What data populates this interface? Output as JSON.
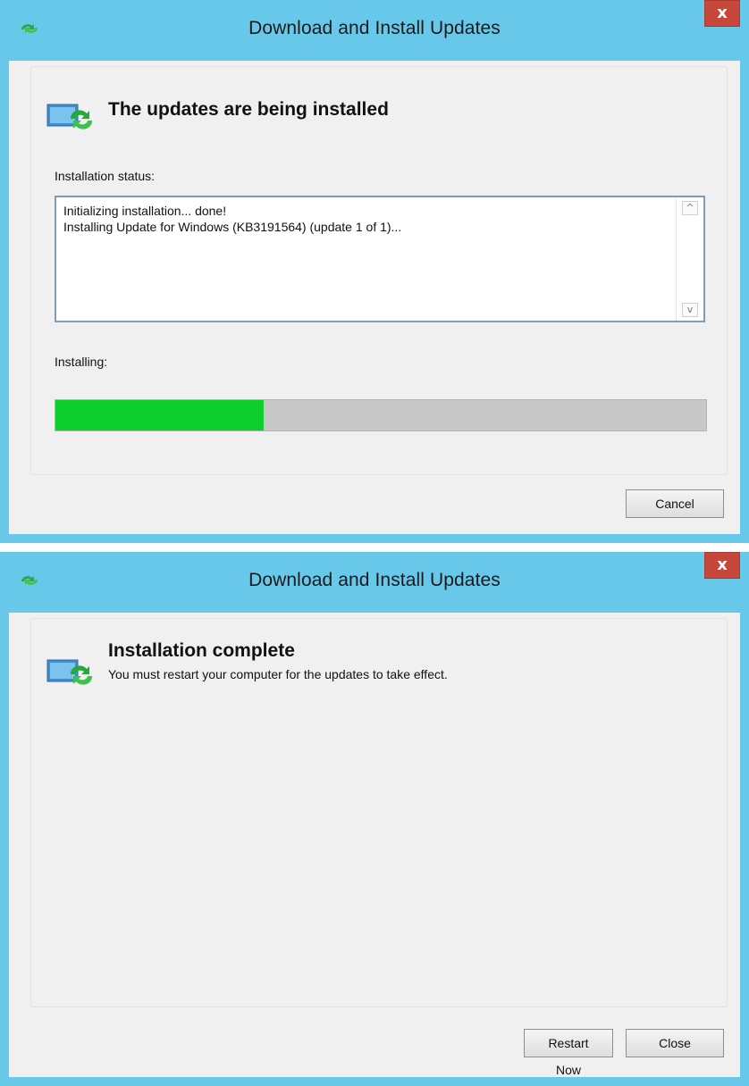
{
  "dialog1": {
    "title": "Download and Install Updates",
    "close_glyph": "x",
    "header_title": "The updates are being installed",
    "status_label": "Installation status:",
    "status_lines": [
      "Initializing installation... done!",
      "Installing Update for Windows (KB3191564) (update 1 of 1)..."
    ],
    "installing_label": "Installing:",
    "progress_fraction": 0.32,
    "cancel_label": "Cancel"
  },
  "dialog2": {
    "title": "Download and Install Updates",
    "close_glyph": "x",
    "header_title": "Installation complete",
    "header_subtitle": "You must restart your computer for the updates to take effect.",
    "restart_label": "Restart Now",
    "close_label": "Close"
  },
  "icons": {
    "title": "windows-update-icon",
    "header": "update-monitor-icon",
    "scroll_up": "scroll-up-arrow-icon",
    "scroll_down": "scroll-down-arrow-icon"
  },
  "colors": {
    "frame": "#68c8ea",
    "close_button": "#c7473a",
    "progress_fill": "#0ece2e",
    "progress_track": "#c8c8c8"
  },
  "glyphs": {
    "scroll_up": "^",
    "scroll_down": "v"
  }
}
